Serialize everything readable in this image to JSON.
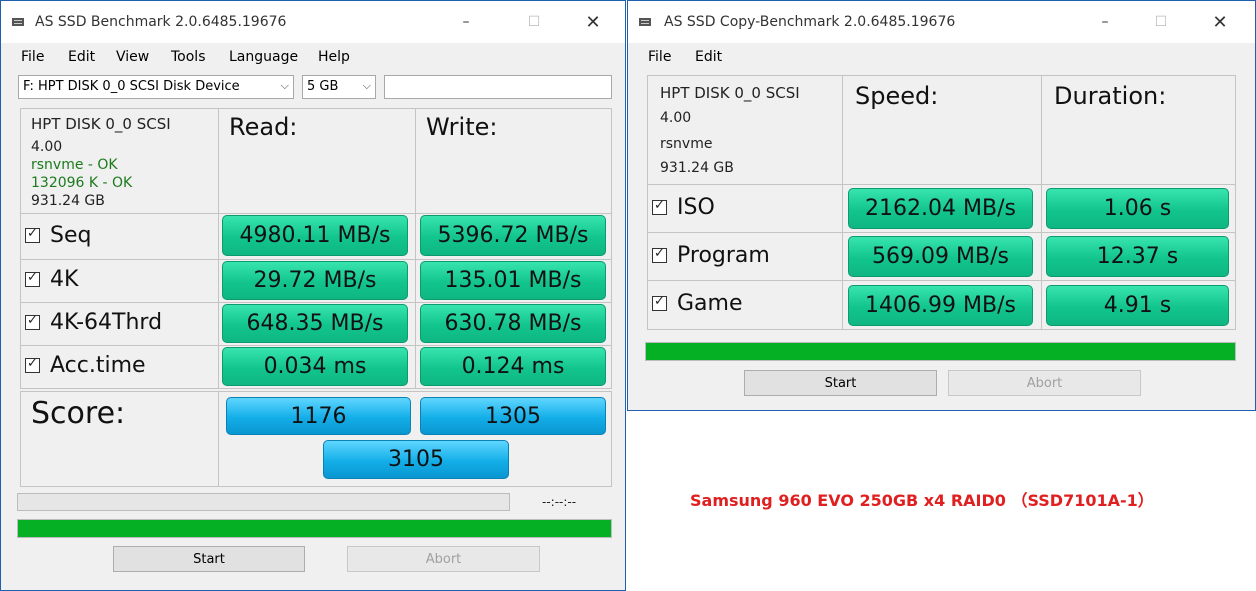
{
  "win1": {
    "title": "AS SSD Benchmark 2.0.6485.19676",
    "menu": [
      "File",
      "Edit",
      "View",
      "Tools",
      "Language",
      "Help"
    ],
    "drive_select": "F: HPT DISK 0_0 SCSI Disk Device",
    "size_select": "5 GB",
    "info": {
      "name": "HPT DISK 0_0 SCSI",
      "version": "4.00",
      "driver": "rsnvme - OK",
      "align": "132096 K - OK",
      "capacity": "931.24 GB"
    },
    "headers": {
      "read": "Read:",
      "write": "Write:"
    },
    "rows": [
      {
        "label": "Seq",
        "read": "4980.11 MB/s",
        "write": "5396.72 MB/s"
      },
      {
        "label": "4K",
        "read": "29.72 MB/s",
        "write": "135.01 MB/s"
      },
      {
        "label": "4K-64Thrd",
        "read": "648.35 MB/s",
        "write": "630.78 MB/s"
      },
      {
        "label": "Acc.time",
        "read": "0.034 ms",
        "write": "0.124 ms"
      }
    ],
    "score": {
      "label": "Score:",
      "read": "1176",
      "write": "1305",
      "total": "3105"
    },
    "time_display": "--:--:--",
    "buttons": {
      "start": "Start",
      "abort": "Abort"
    }
  },
  "win2": {
    "title": "AS SSD Copy-Benchmark 2.0.6485.19676",
    "menu": [
      "File",
      "Edit"
    ],
    "info": {
      "name": "HPT DISK 0_0 SCSI",
      "version": "4.00",
      "driver": "rsnvme",
      "capacity": "931.24 GB"
    },
    "headers": {
      "speed": "Speed:",
      "duration": "Duration:"
    },
    "rows": [
      {
        "label": "ISO",
        "speed": "2162.04 MB/s",
        "duration": "1.06 s"
      },
      {
        "label": "Program",
        "speed": "569.09 MB/s",
        "duration": "12.37 s"
      },
      {
        "label": "Game",
        "speed": "1406.99 MB/s",
        "duration": "4.91 s"
      }
    ],
    "buttons": {
      "start": "Start",
      "abort": "Abort"
    }
  },
  "caption": "Samsung 960 EVO 250GB x4 RAID0 （SSD7101A-1）",
  "colors": {
    "value_green": "#12c58d",
    "score_blue": "#13aee8",
    "progress_green": "#06b025",
    "caption_red": "#e02020",
    "window_border": "#1f5fb0"
  }
}
